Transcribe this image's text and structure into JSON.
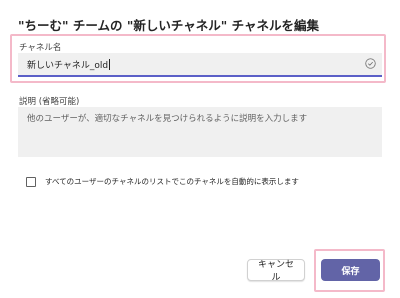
{
  "dialog": {
    "title": "\"ちーむ\" チームの \"新しいチャネル\" チャネルを編集",
    "name_field": {
      "label": "チャネル名",
      "value": "新しいチャネル_old",
      "icon": "check-circle-icon"
    },
    "description_field": {
      "label": "説明 (省略可能)",
      "placeholder": "他のユーザーが、適切なチャネルを見つけられるように説明を入力します"
    },
    "auto_show_checkbox": {
      "label": "すべてのユーザーのチャネルのリストでこのチャネルを自動的に表示します",
      "checked": false
    },
    "buttons": {
      "cancel": "キャンセル",
      "save": "保存"
    }
  },
  "colors": {
    "accent": "#6264a7",
    "field_underline": "#5b5fc7",
    "highlight": "#f4b9c9",
    "field_background": "#f0f0f0"
  }
}
